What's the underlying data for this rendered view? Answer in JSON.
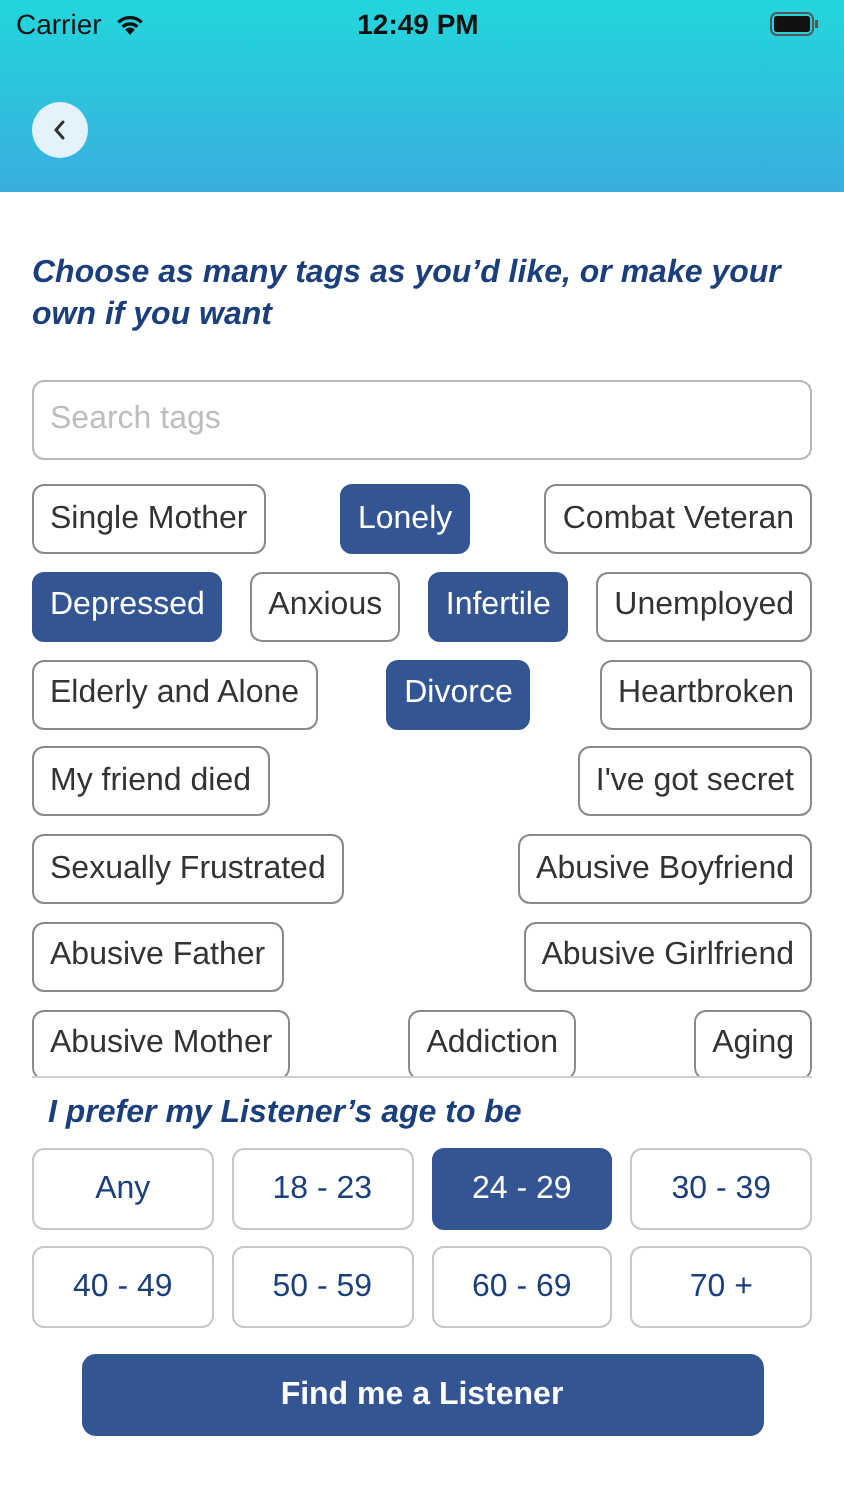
{
  "status_bar": {
    "carrier": "Carrier",
    "time": "12:49 PM"
  },
  "heading": "Choose as many tags as you’d like, or make your own if you want",
  "search": {
    "placeholder": "Search tags"
  },
  "tag_rows": [
    [
      {
        "label": "Single Mother",
        "selected": false
      },
      {
        "label": "Lonely",
        "selected": true
      },
      {
        "label": "Combat Veteran",
        "selected": false
      }
    ],
    [
      {
        "label": "Depressed",
        "selected": true
      },
      {
        "label": "Anxious",
        "selected": false
      },
      {
        "label": "Infertile",
        "selected": true
      },
      {
        "label": "Unemployed",
        "selected": false
      }
    ],
    [
      {
        "label": "Elderly and Alone",
        "selected": false
      },
      {
        "label": "Divorce",
        "selected": true
      },
      {
        "label": "Heartbroken",
        "selected": false
      }
    ],
    [
      {
        "label": "My friend died",
        "selected": false
      },
      {
        "label": "I've got secret",
        "selected": false
      }
    ],
    [
      {
        "label": "Sexually Frustrated",
        "selected": false
      },
      {
        "label": "Abusive Boyfriend",
        "selected": false
      }
    ],
    [
      {
        "label": "Abusive Father",
        "selected": false
      },
      {
        "label": "Abusive Girlfriend",
        "selected": false
      }
    ],
    [
      {
        "label": "Abusive Mother",
        "selected": false
      },
      {
        "label": "Addiction",
        "selected": false
      },
      {
        "label": "Aging",
        "selected": false
      }
    ]
  ],
  "age_label": "I prefer my Listener’s age to be",
  "age_options": [
    {
      "label": "Any",
      "selected": false
    },
    {
      "label": "18 - 23",
      "selected": false
    },
    {
      "label": "24 - 29",
      "selected": true
    },
    {
      "label": "30 - 39",
      "selected": false
    },
    {
      "label": "40 - 49",
      "selected": false
    },
    {
      "label": "50 - 59",
      "selected": false
    },
    {
      "label": "60 - 69",
      "selected": false
    },
    {
      "label": "70 +",
      "selected": false
    }
  ],
  "submit_button": "Find me a Listener"
}
